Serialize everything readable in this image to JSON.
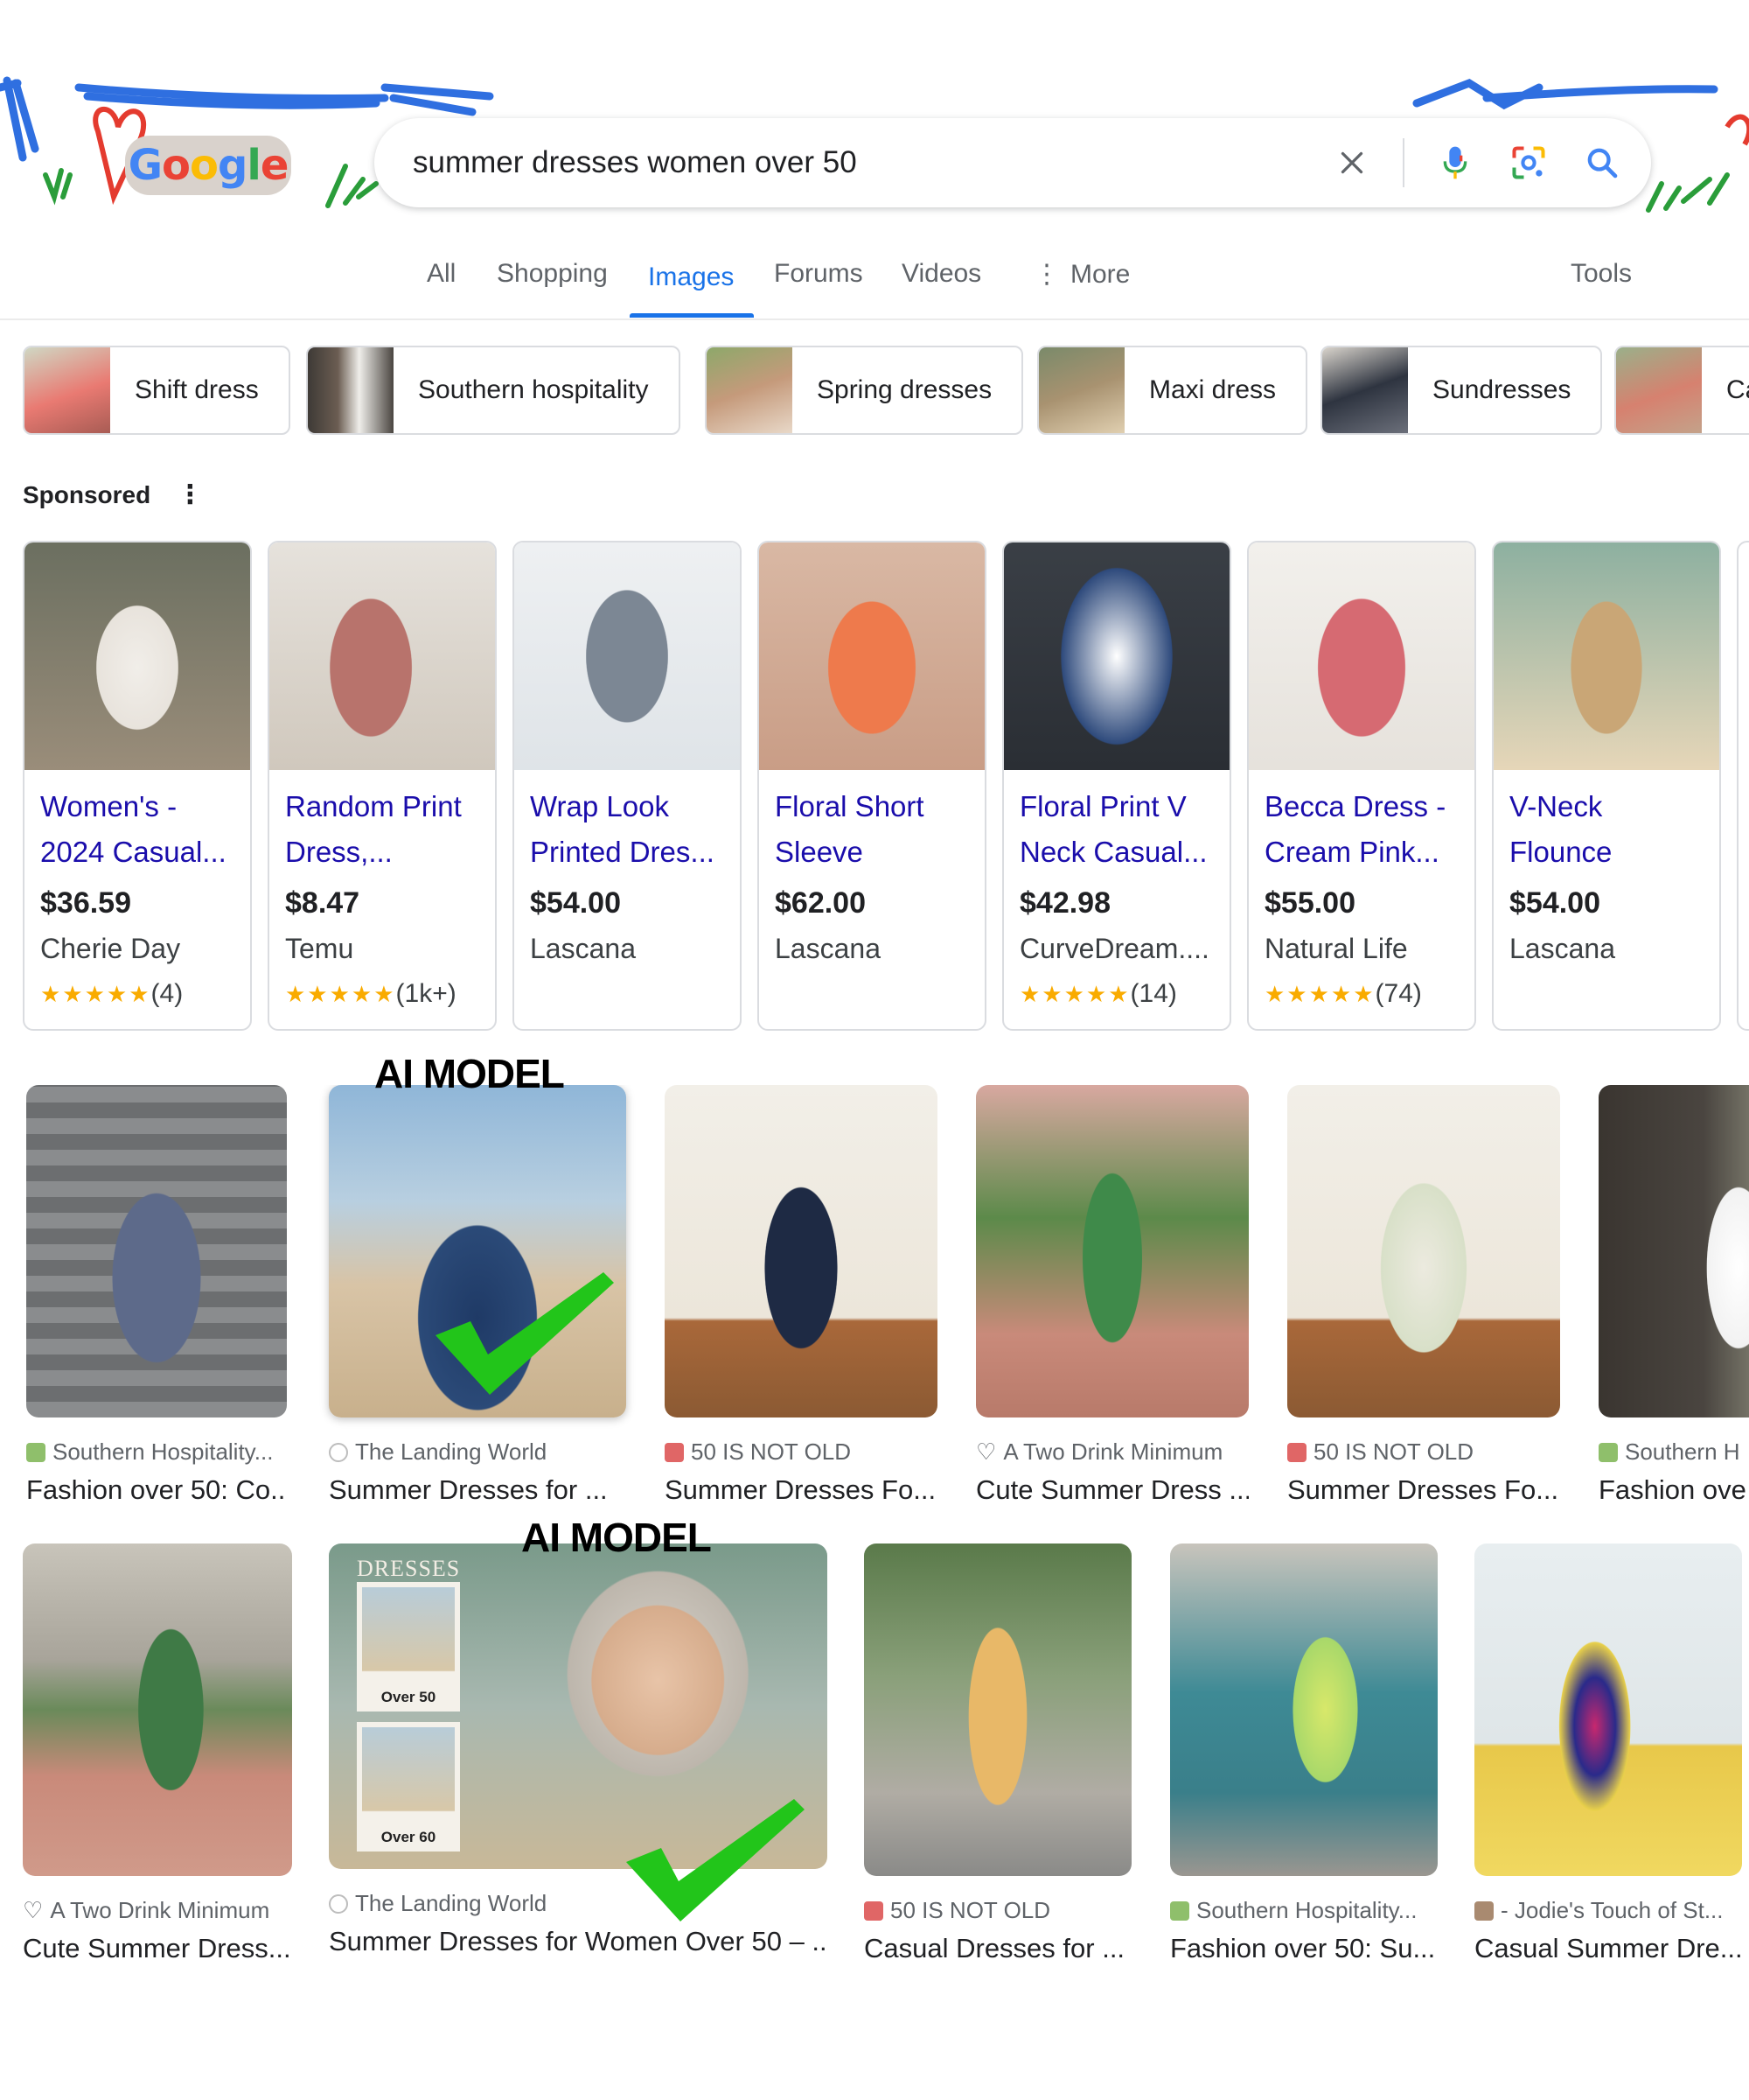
{
  "search": {
    "query": "summer dresses women over 50"
  },
  "logo": {
    "text": "Google"
  },
  "tabs": [
    {
      "label": "All"
    },
    {
      "label": "Shopping"
    },
    {
      "label": "Images"
    },
    {
      "label": "Forums"
    },
    {
      "label": "Videos"
    },
    {
      "label": "More"
    }
  ],
  "active_tab": "Images",
  "tools_label": "Tools",
  "chips": [
    {
      "label": "Shift dress",
      "color": "#e97a72"
    },
    {
      "label": "Southern hospitality",
      "color": "#6b5d52"
    },
    {
      "label": "Spring dresses",
      "color": "#c59a7b"
    },
    {
      "label": "Maxi dress",
      "color": "#a89270"
    },
    {
      "label": "Sundresses",
      "color": "#2e3440"
    },
    {
      "label": "Ca",
      "color": "#d6816f"
    }
  ],
  "sponsored_label": "Sponsored",
  "products": [
    {
      "title": "Women's - 2024 Casual...",
      "price": "$36.59",
      "seller": "Cherie Day",
      "stars": "★★★★★",
      "rating": "(4)",
      "color": "#e8e3dc"
    },
    {
      "title": "Random Print Dress,...",
      "price": "$8.47",
      "seller": "Temu",
      "stars": "★★★★★",
      "rating": "(1k+)",
      "color": "#b8736c"
    },
    {
      "title": "Wrap Look Printed Dres...",
      "price": "$54.00",
      "seller": "Lascana",
      "stars": "",
      "rating": "",
      "color": "#7c8794"
    },
    {
      "title": "Floral Short Sleeve Dress,...",
      "price": "$62.00",
      "seller": "Lascana",
      "stars": "",
      "rating": "",
      "color": "#ee7a4c"
    },
    {
      "title": "Floral Print V Neck Casual...",
      "price": "$42.98",
      "seller": "CurveDream....",
      "stars": "★★★★★",
      "rating": "(14)",
      "color": "#2e4a7c"
    },
    {
      "title": "Becca Dress - Cream Pink...",
      "price": "$55.00",
      "seller": "Natural Life",
      "stars": "★★★★★",
      "rating": "(74)",
      "color": "#d66a72"
    },
    {
      "title": "V-Neck Flounce Dres...",
      "price": "$54.00",
      "seller": "Lascana",
      "stars": "",
      "rating": "",
      "color": "#c9a676"
    }
  ],
  "results_row1": [
    {
      "source": "Southern Hospitality...",
      "title": "Fashion over 50: Co...",
      "fav": "#8fbf6b",
      "color": "#5d6270"
    },
    {
      "source": "The Landing World",
      "title": "Summer Dresses for ...",
      "fav": "#bdbdbd",
      "color": "#3a5f86"
    },
    {
      "source": "50 IS NOT OLD",
      "title": "Summer Dresses Fo...",
      "fav": "#e06666",
      "color": "#8b6a4e"
    },
    {
      "source": "A Two Drink Minimum",
      "title": "Cute Summer Dress ...",
      "fav": "#ffffff",
      "color": "#5c8a4a"
    },
    {
      "source": "50 IS NOT OLD",
      "title": "Summer Dresses Fo...",
      "fav": "#e06666",
      "color": "#a88d73"
    },
    {
      "source": "Southern H",
      "title": "Fashion ove",
      "fav": "#8fbf6b",
      "color": "#4a4540"
    }
  ],
  "results_row2": [
    {
      "source": "A Two Drink Minimum",
      "title": "Cute Summer Dress...",
      "fav": "#ffffff",
      "color": "#6a8a5a"
    },
    {
      "source": "The Landing World",
      "title": "Summer Dresses for Women Over 50 – ...",
      "fav": "#bdbdbd",
      "color": "#7a8f9e"
    },
    {
      "source": "50 IS NOT OLD",
      "title": "Casual Dresses for ...",
      "fav": "#e06666",
      "color": "#6b7a5a"
    },
    {
      "source": "Southern Hospitality...",
      "title": "Fashion over 50: Su...",
      "fav": "#8fbf6b",
      "color": "#3e8a95"
    },
    {
      "source": "- Jodie's Touch of St...",
      "title": "Casual Summer Dre...",
      "fav": "#a98a70",
      "color": "#5a6f7c"
    }
  ],
  "inset_labels": {
    "top": "Over 50",
    "bottom": "Over 60",
    "banner": "DRESSES"
  },
  "annotations": {
    "ai_label_1": "AI MODEL",
    "ai_label_2": "AI MODEL"
  }
}
